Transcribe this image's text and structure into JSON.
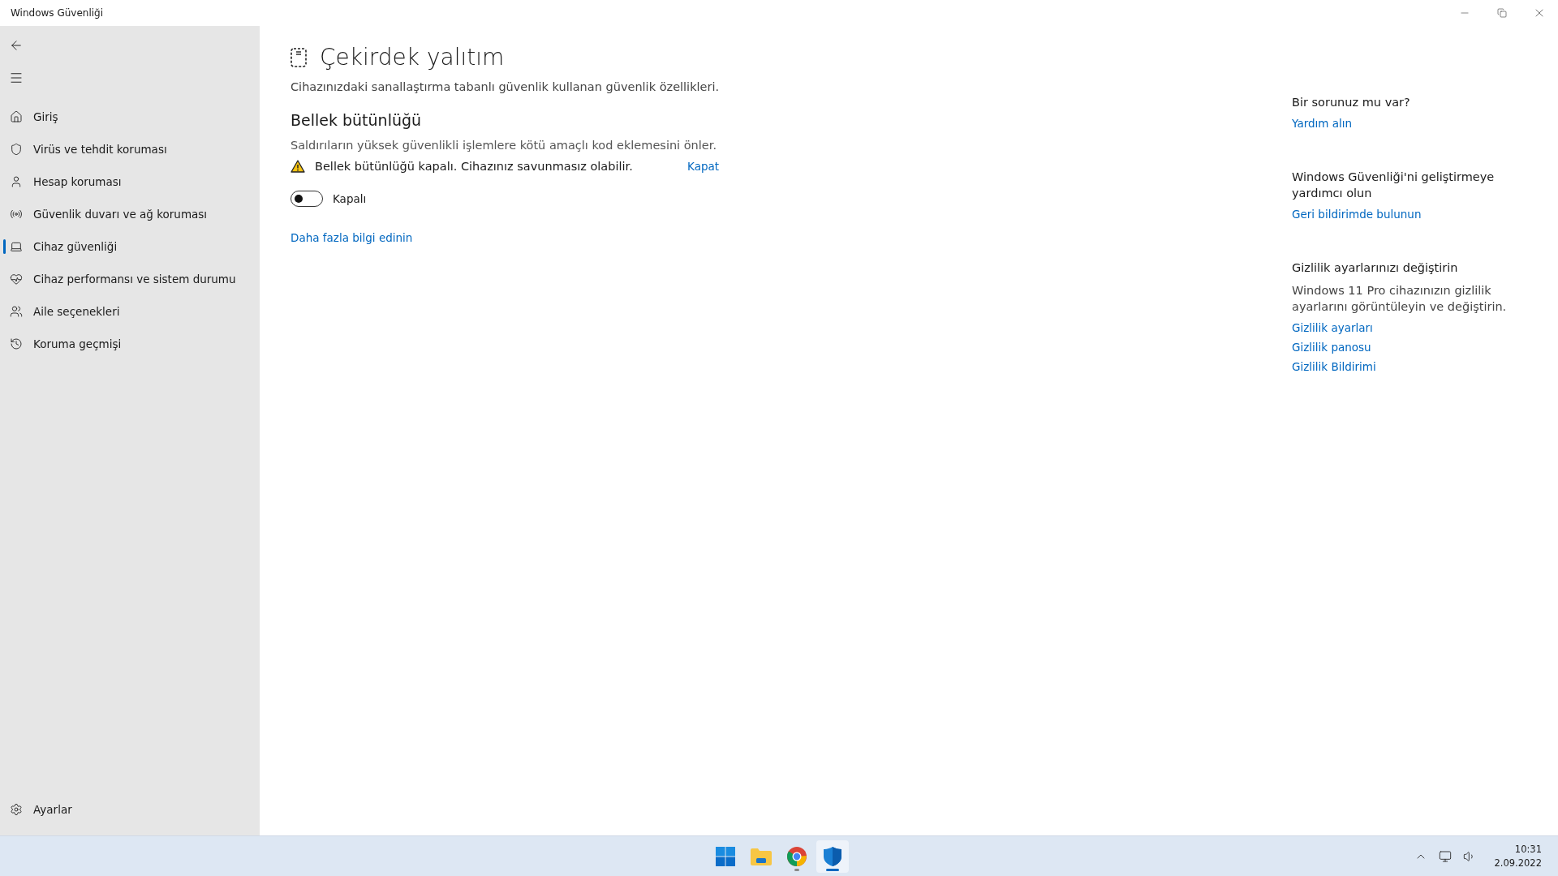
{
  "window": {
    "title": "Windows Güvenliği"
  },
  "sidebar": {
    "items": [
      {
        "label": "Giriş",
        "kind": "home",
        "selected": false
      },
      {
        "label": "Virüs ve tehdit koruması",
        "kind": "shield",
        "selected": false
      },
      {
        "label": "Hesap koruması",
        "kind": "person",
        "selected": false
      },
      {
        "label": "Güvenlik duvarı ve ağ koruması",
        "kind": "antenna",
        "selected": false
      },
      {
        "label": "Cihaz güvenliği",
        "kind": "laptop",
        "selected": true
      },
      {
        "label": "Cihaz performansı ve sistem durumu",
        "kind": "heart",
        "selected": false
      },
      {
        "label": "Aile seçenekleri",
        "kind": "family",
        "selected": false
      },
      {
        "label": "Koruma geçmişi",
        "kind": "history",
        "selected": false
      }
    ],
    "settings": {
      "label": "Ayarlar"
    }
  },
  "page": {
    "title": "Çekirdek yalıtım",
    "subtitle": "Cihazınızdaki sanallaştırma tabanlı güvenlik kullanan güvenlik özellikleri.",
    "section": {
      "title": "Bellek bütünlüğü",
      "description": "Saldırıların yüksek güvenlikli işlemlere kötü amaçlı kod eklemesini önler.",
      "warning": {
        "text": "Bellek bütünlüğü kapalı. Cihazınız savunmasız olabilir.",
        "action": "Kapat"
      },
      "toggle": {
        "on": false,
        "label": "Kapalı"
      },
      "link": "Daha fazla bilgi edinin"
    }
  },
  "aside": [
    {
      "title": "Bir sorunuz mu var?",
      "links": [
        "Yardım alın"
      ]
    },
    {
      "title": "Windows Güvenliği'ni geliştirmeye yardımcı olun",
      "links": [
        "Geri bildirimde bulunun"
      ]
    },
    {
      "title": "Gizlilik ayarlarınızı değiştirin",
      "text": "Windows 11 Pro cihazınızın gizlilik ayarlarını görüntüleyin ve değiştirin.",
      "links": [
        "Gizlilik ayarları",
        "Gizlilik panosu",
        "Gizlilik Bildirimi"
      ]
    }
  ],
  "taskbar": {
    "apps": [
      {
        "kind": "start",
        "running": false,
        "selected": false
      },
      {
        "kind": "folder",
        "running": false,
        "selected": false
      },
      {
        "kind": "browser",
        "running": true,
        "selected": false
      },
      {
        "kind": "shield",
        "running": true,
        "selected": true
      }
    ],
    "time": "10:31",
    "date": "2.09.2022"
  }
}
